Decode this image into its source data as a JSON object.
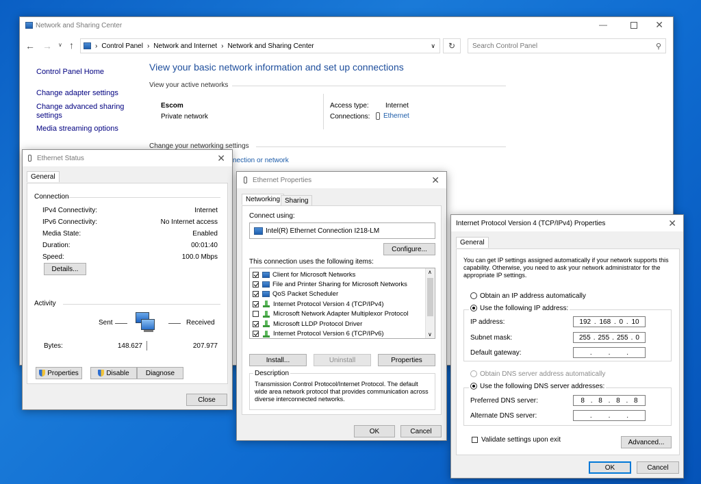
{
  "nsc": {
    "title": "Network and Sharing Center",
    "breadcrumb": [
      "Control Panel",
      "Network and Internet",
      "Network and Sharing Center"
    ],
    "search_placeholder": "Search Control Panel",
    "sidebar": [
      "Control Panel Home",
      "Change adapter settings",
      "Change advanced sharing settings",
      "Media streaming options"
    ],
    "heading": "View your basic network information and set up connections",
    "active_networks": "View your active networks",
    "network_name": "Escom",
    "network_type": "Private network",
    "access_type_label": "Access type:",
    "access_type_value": "Internet",
    "connections_label": "Connections:",
    "connections_value": "Ethernet",
    "change_settings": "Change your networking settings",
    "setup_link_fragment": "nection or network"
  },
  "eth_status": {
    "title": "Ethernet Status",
    "tab": "General",
    "connection_label": "Connection",
    "rows": [
      {
        "label": "IPv4 Connectivity:",
        "value": "Internet"
      },
      {
        "label": "IPv6 Connectivity:",
        "value": "No Internet access"
      },
      {
        "label": "Media State:",
        "value": "Enabled"
      },
      {
        "label": "Duration:",
        "value": "00:01:40"
      },
      {
        "label": "Speed:",
        "value": "100.0 Mbps"
      }
    ],
    "details": "Details...",
    "activity_label": "Activity",
    "sent": "Sent",
    "received": "Received",
    "bytes_label": "Bytes:",
    "bytes_sent": "148.627",
    "bytes_received": "207.977",
    "properties": "Properties",
    "disable": "Disable",
    "diagnose": "Diagnose",
    "close": "Close"
  },
  "eth_props": {
    "title": "Ethernet Properties",
    "tabs": [
      "Networking",
      "Sharing"
    ],
    "connect_using": "Connect using:",
    "adapter": "Intel(R) Ethernet Connection I218-LM",
    "configure": "Configure...",
    "items_label": "This connection uses the following items:",
    "items": [
      {
        "label": "Client for Microsoft Networks",
        "checked": true,
        "icon": "network-client-icon"
      },
      {
        "label": "File and Printer Sharing for Microsoft Networks",
        "checked": true,
        "icon": "network-client-icon"
      },
      {
        "label": "QoS Packet Scheduler",
        "checked": true,
        "icon": "network-client-icon"
      },
      {
        "label": "Internet Protocol Version 4 (TCP/IPv4)",
        "checked": true,
        "icon": "protocol-icon"
      },
      {
        "label": "Microsoft Network Adapter Multiplexor Protocol",
        "checked": false,
        "icon": "protocol-icon"
      },
      {
        "label": "Microsoft LLDP Protocol Driver",
        "checked": true,
        "icon": "protocol-icon"
      },
      {
        "label": "Internet Protocol Version 6 (TCP/IPv6)",
        "checked": true,
        "icon": "protocol-icon"
      }
    ],
    "install": "Install...",
    "uninstall": "Uninstall",
    "properties": "Properties",
    "description_label": "Description",
    "description": "Transmission Control Protocol/Internet Protocol. The default wide area network protocol that provides communication across diverse interconnected networks.",
    "ok": "OK",
    "cancel": "Cancel"
  },
  "ipv4": {
    "title": "Internet Protocol Version 4 (TCP/IPv4) Properties",
    "tab": "General",
    "intro": "You can get IP settings assigned automatically if your network supports this capability. Otherwise, you need to ask your network administrator for the appropriate IP settings.",
    "obtain_ip_auto": "Obtain an IP address automatically",
    "use_following_ip": "Use the following IP address:",
    "ip_label": "IP address:",
    "ip": [
      "192",
      "168",
      "0",
      "10"
    ],
    "mask_label": "Subnet mask:",
    "mask": [
      "255",
      "255",
      "255",
      "0"
    ],
    "gateway_label": "Default gateway:",
    "gateway": [
      "",
      "",
      "",
      ""
    ],
    "obtain_dns_auto": "Obtain DNS server address automatically",
    "use_following_dns": "Use the following DNS server addresses:",
    "pref_dns_label": "Preferred DNS server:",
    "pref_dns": [
      "8",
      "8",
      "8",
      "8"
    ],
    "alt_dns_label": "Alternate DNS server:",
    "alt_dns": [
      "",
      "",
      "",
      ""
    ],
    "validate": "Validate settings upon exit",
    "advanced": "Advanced...",
    "ok": "OK",
    "cancel": "Cancel"
  }
}
